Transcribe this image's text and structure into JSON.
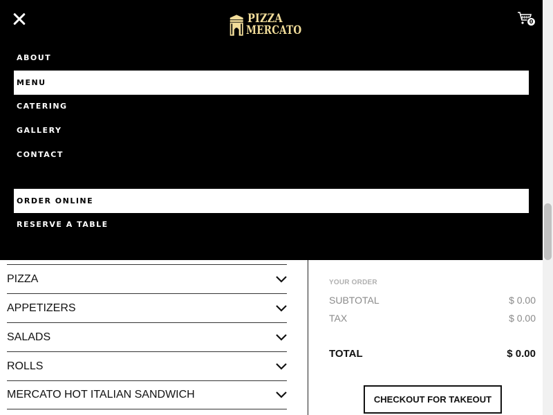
{
  "header": {
    "logo_line1": "PIZZA",
    "logo_line2": "MERCATO",
    "cart_count": "0",
    "logo_color": "#f2dd9a"
  },
  "nav": {
    "items": [
      {
        "label": "ABOUT",
        "active": false
      },
      {
        "label": "MENU",
        "active": true
      },
      {
        "label": "CATERING",
        "active": false
      },
      {
        "label": "GALLERY",
        "active": false
      },
      {
        "label": "CONTACT",
        "active": false
      },
      {
        "label": "ORDER ONLINE",
        "active": true
      },
      {
        "label": "RESERVE A TABLE",
        "active": false
      }
    ]
  },
  "menu": {
    "categories": [
      {
        "label": "PIZZA"
      },
      {
        "label": "APPETIZERS"
      },
      {
        "label": "SALADS"
      },
      {
        "label": "ROLLS"
      },
      {
        "label": "MERCATO HOT ITALIAN SANDWICH"
      }
    ]
  },
  "order": {
    "heading": "YOUR ORDER",
    "subtotal_label": "SUBTOTAL",
    "subtotal_value": "$ 0.00",
    "tax_label": "TAX",
    "tax_value": "$ 0.00",
    "total_label": "TOTAL",
    "total_value": "$ 0.00",
    "checkout_label": "CHECKOUT FOR TAKEOUT"
  }
}
